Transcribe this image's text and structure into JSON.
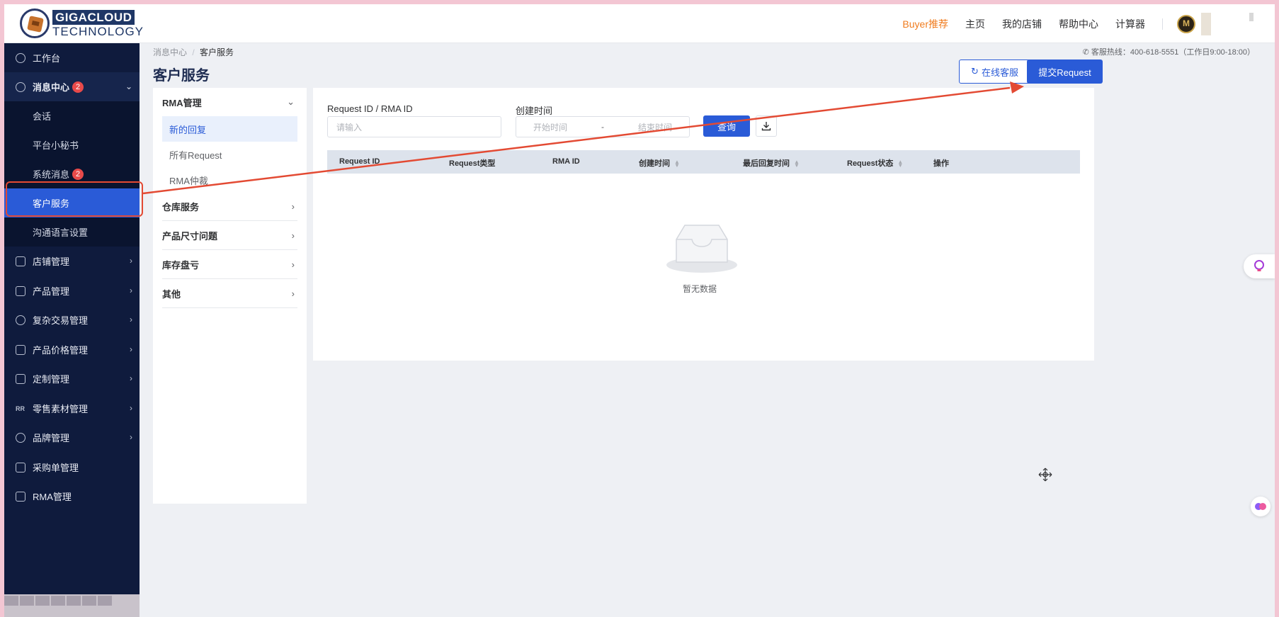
{
  "header": {
    "logo_line1": "GIGACLOUD",
    "logo_line2": "TECHNOLOGY",
    "nav": [
      "Buyer推荐",
      "主页",
      "我的店铺",
      "帮助中心",
      "计算器"
    ]
  },
  "sidebar": {
    "workbench": "工作台",
    "message_center": "消息中心",
    "message_center_badge": "2",
    "subs": [
      "会话",
      "平台小秘书",
      "系统消息",
      "客户服务",
      "沟通语言设置"
    ],
    "system_msg_badge": "2",
    "items": [
      "店铺管理",
      "产品管理",
      "复杂交易管理",
      "产品价格管理",
      "定制管理",
      "零售素材管理",
      "品牌管理",
      "采购单管理",
      "RMA管理"
    ],
    "rr_icon_text": "RR"
  },
  "page": {
    "breadcrumb_parent": "消息中心",
    "breadcrumb_sep": "/",
    "breadcrumb_current": "客户服务",
    "title": "客户服务",
    "hotline": "客服热线：400-618-5551（工作日9:00-18:00）",
    "online_service": "在线客服",
    "submit_request": "提交Request"
  },
  "categories": {
    "rma_head": "RMA管理",
    "rma_subs": [
      "新的回复",
      "所有Request",
      "RMA仲裁"
    ],
    "others": [
      "仓库服务",
      "产品尺寸问题",
      "库存盘亏",
      "其他"
    ]
  },
  "filters": {
    "id_label": "Request ID / RMA ID",
    "id_placeholder": "请输入",
    "time_label": "创建时间",
    "start_placeholder": "开始时间",
    "range_sep": "-",
    "end_placeholder": "结束时间",
    "query_button": "查询"
  },
  "table": {
    "columns": [
      "Request ID",
      "Request类型",
      "RMA ID",
      "创建时间",
      "最后回复时间",
      "Request状态",
      "操作"
    ],
    "empty_text": "暂无数据"
  },
  "colors": {
    "sidebar_bg": "#0f1b3d",
    "accent": "#2a5bd7",
    "buyer_orange": "#f07c1f",
    "annotation_red": "#e34a33"
  }
}
